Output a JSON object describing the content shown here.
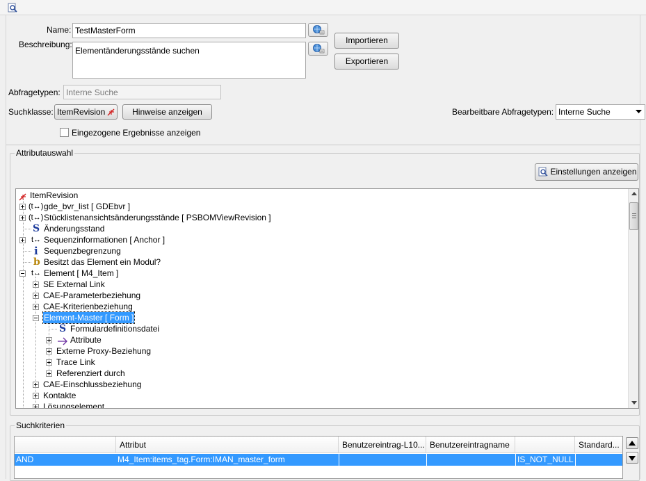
{
  "toolbar": {
    "search_icon": "search-page-icon"
  },
  "form": {
    "name_label": "Name:",
    "name_value": "TestMasterForm",
    "desc_label": "Beschreibung:",
    "desc_value": "Elementänderungsstände suchen",
    "import_button": "Importieren",
    "export_button": "Exportieren",
    "query_types_label": "Abfragetypen:",
    "query_types_placeholder": "Interne Suche",
    "search_class_label": "Suchklasse:",
    "search_class_value": "ItemRevision",
    "hints_button": "Hinweise anzeigen",
    "editable_types_label": "Bearbeitbare Abfragetypen:",
    "editable_types_value": "Interne Suche",
    "show_drilled_label": "Eingezogene Ergebnisse anzeigen",
    "show_drilled_checked": false
  },
  "attributes": {
    "title": "Attributauswahl",
    "settings_button": "Einstellungen anzeigen",
    "tree": [
      {
        "label": "ItemRevision",
        "icon": "item-revision-icon"
      },
      {
        "label": "gde_bvr_list [ GDEbvr ]",
        "icon": "list-reference-icon"
      },
      {
        "label": "Stücklistenansichtsänderungsstände [ PSBOMViewRevision ]",
        "icon": "list-reference-icon"
      },
      {
        "label": "Änderungsstand",
        "icon": "string-type-icon"
      },
      {
        "label": "Sequenzinformationen [ Anchor ]",
        "icon": "reference-icon"
      },
      {
        "label": "Sequenzbegrenzung",
        "icon": "integer-type-icon"
      },
      {
        "label": "Besitzt das Element ein Modul?",
        "icon": "boolean-type-icon"
      },
      {
        "label": "Element [ M4_Item ]",
        "icon": "reference-icon"
      },
      {
        "label": "SE External Link",
        "icon": ""
      },
      {
        "label": "CAE-Parameterbeziehung",
        "icon": ""
      },
      {
        "label": "CAE-Kriterienbeziehung",
        "icon": ""
      },
      {
        "label": "Element-Master [ Form ]",
        "icon": "",
        "selected": true
      },
      {
        "label": "Formulardefinitionsdatei",
        "icon": "string-type-icon"
      },
      {
        "label": "Attribute",
        "icon": "arrow-reference-icon"
      },
      {
        "label": "Externe Proxy-Beziehung",
        "icon": ""
      },
      {
        "label": "Trace Link",
        "icon": ""
      },
      {
        "label": "Referenziert durch",
        "icon": ""
      },
      {
        "label": "CAE-Einschlussbeziehung",
        "icon": ""
      },
      {
        "label": "Kontakte",
        "icon": ""
      },
      {
        "label": "Lösungselement",
        "icon": ""
      }
    ]
  },
  "criteria": {
    "title": "Suchkriterien",
    "columns": [
      "",
      "Attribut",
      "Benutzereintrag-L10...",
      "Benutzereintragname",
      "",
      "Standard..."
    ],
    "rows": [
      [
        "AND",
        "M4_Item:items_tag.Form:IMAN_master_form",
        "",
        "",
        "IS_NOT_NULL",
        ""
      ]
    ]
  },
  "colors": {
    "selection": "#3399ff",
    "accent_red": "#d22020",
    "icon_blue": "#1c3b9c",
    "icon_gold": "#b8860b"
  }
}
